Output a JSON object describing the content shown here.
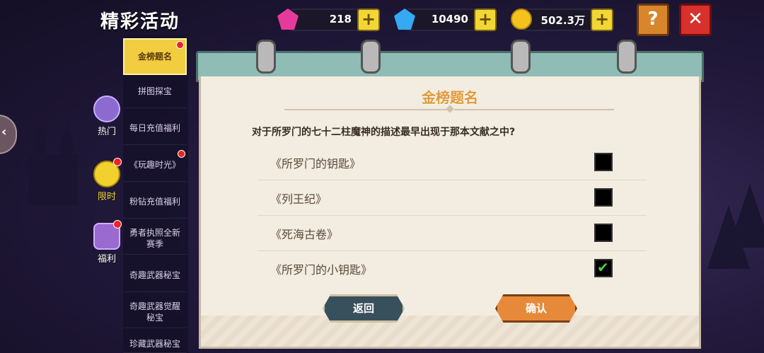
{
  "header": {
    "title": "精彩活动"
  },
  "currencies": [
    {
      "icon": "pink-gem-icon",
      "value": "218"
    },
    {
      "icon": "blue-diamond-icon",
      "value": "10490"
    },
    {
      "icon": "gold-coin-icon",
      "value": "502.3万"
    }
  ],
  "buttons": {
    "help": "?",
    "close": "✕",
    "plus": "+"
  },
  "side_categories": [
    {
      "label": "热门",
      "active": false
    },
    {
      "label": "限时",
      "active": true
    },
    {
      "label": "福利",
      "active": false
    }
  ],
  "tabs": [
    {
      "label": "金榜题名"
    },
    {
      "label": "拼图探宝"
    },
    {
      "label": "每日充值福利"
    },
    {
      "label": "《玩趣时光》"
    },
    {
      "label": "粉钻充值福利"
    },
    {
      "label": "勇者执照全新赛季"
    },
    {
      "label": "奇趣武器秘宝"
    },
    {
      "label": "奇趣武器觉醒秘宝"
    },
    {
      "label": "珍藏武器秘宝"
    }
  ],
  "quiz": {
    "title": "金榜题名",
    "question": "对于所罗门的七十二柱魔神的描述最早出现于那本文献之中?",
    "options": [
      {
        "label": "《所罗门的钥匙》",
        "checked": false
      },
      {
        "label": "《列王纪》",
        "checked": false
      },
      {
        "label": "《死海古卷》",
        "checked": false
      },
      {
        "label": "《所罗门的小钥匙》",
        "checked": true
      }
    ],
    "back_label": "返回",
    "confirm_label": "确认"
  },
  "colors": {
    "accent": "#f1cd3f",
    "panel": "#f3ece0",
    "title": "#e09a3a"
  }
}
